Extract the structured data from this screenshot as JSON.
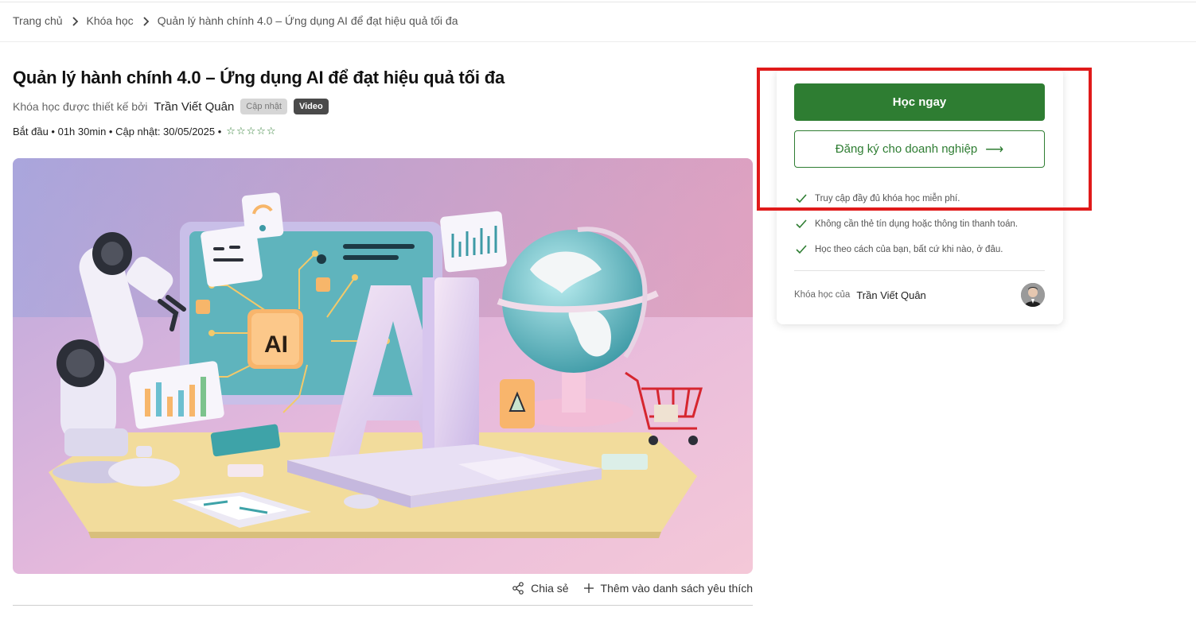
{
  "breadcrumb": {
    "home": "Trang chủ",
    "courses": "Khóa học",
    "current": "Quản lý hành chính 4.0 – Ứng dụng AI để đạt hiệu quả tối đa"
  },
  "course": {
    "title": "Quản lý hành chính 4.0 – Ứng dụng AI để đạt hiệu quả tối đa",
    "designed_by_label": "Khóa học được thiết kế bởi",
    "designer": "Trần Viết Quân",
    "badge_update": "Cập nhật",
    "badge_video": "Video",
    "meta": "Bắt đầu • 01h 30min • Cập nhật: 30/05/2025 •",
    "rating": 0,
    "rating_max": 5,
    "stars": "☆☆☆☆☆",
    "hero_ai_text": "AI"
  },
  "actions": {
    "share": "Chia sẻ",
    "wishlist": "Thêm vào danh sách yêu thích"
  },
  "sidebar": {
    "primary_button": "Học ngay",
    "business_button": "Đăng ký cho doanh nghiệp",
    "business_arrow": "⟶",
    "benefits": [
      "Truy cập đầy đủ khóa học miễn phí.",
      "Không cần thẻ tín dụng hoặc thông tin thanh toán.",
      "Học theo cách của bạn, bất cứ khi nào, ở đâu."
    ],
    "course_by_label": "Khóa học của",
    "author": "Trần Viết Quân"
  },
  "colors": {
    "accent": "#2e7d32",
    "highlight": "#e01a1a"
  }
}
